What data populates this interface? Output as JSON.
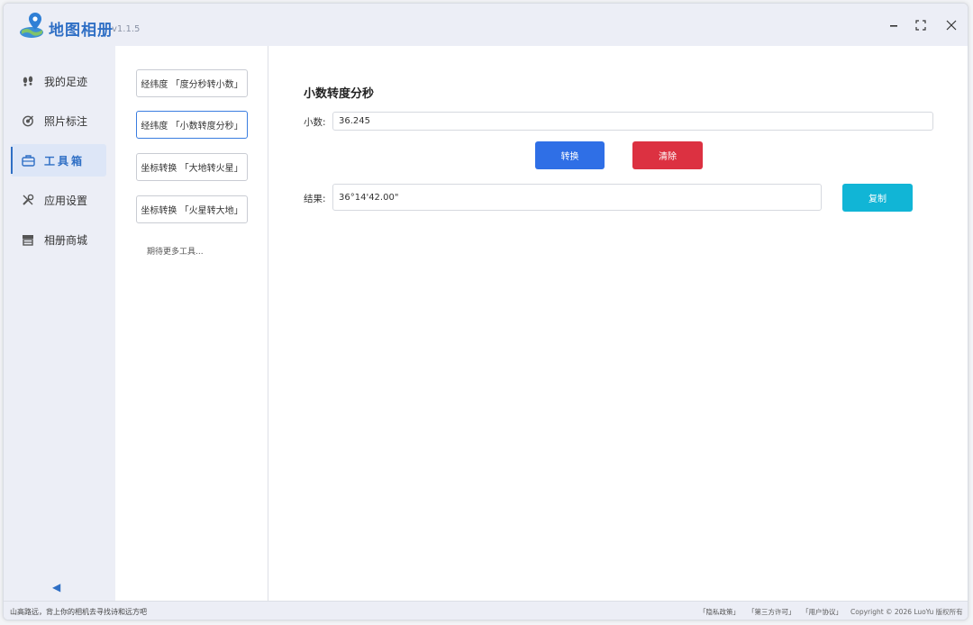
{
  "app": {
    "title": "地图相册",
    "version": "v1.1.5"
  },
  "window_controls": {
    "minimize": "–",
    "maximize": "⛶",
    "close": "✕"
  },
  "sidebar": {
    "items": [
      {
        "label": "我的足迹",
        "icon": "footprints-icon"
      },
      {
        "label": "照片标注",
        "icon": "target-icon"
      },
      {
        "label": "工具箱",
        "icon": "toolbox-icon",
        "active": true
      },
      {
        "label": "应用设置",
        "icon": "wrench-icon"
      },
      {
        "label": "相册商城",
        "icon": "store-icon"
      }
    ],
    "collapse": "◀"
  },
  "tools": {
    "items": [
      {
        "label": "经纬度 「度分秒转小数」"
      },
      {
        "label": "经纬度 「小数转度分秒」",
        "active": true
      },
      {
        "label": "坐标转换 「大地转火星」"
      },
      {
        "label": "坐标转换 「火星转大地」"
      }
    ],
    "more": "期待更多工具..."
  },
  "converter": {
    "title": "小数转度分秒",
    "input_label": "小数:",
    "input_value": "36.245",
    "convert_label": "转换",
    "clear_label": "清除",
    "result_label": "结果:",
    "result_value": "36°14'42.00\"",
    "copy_label": "复制"
  },
  "status": {
    "slogan": "山高路远，背上你的相机去寻找诗和远方吧",
    "privacy": "「隐私政策」",
    "third_party": "「第三方许可」",
    "agreement": "「用户协议」",
    "copyright": "Copyright © 2026 LuoYu 版权所有"
  },
  "colors": {
    "accent": "#2f6fc5",
    "convert": "#2f6fe6",
    "clear": "#dc3141",
    "copy": "#11b5d6"
  }
}
